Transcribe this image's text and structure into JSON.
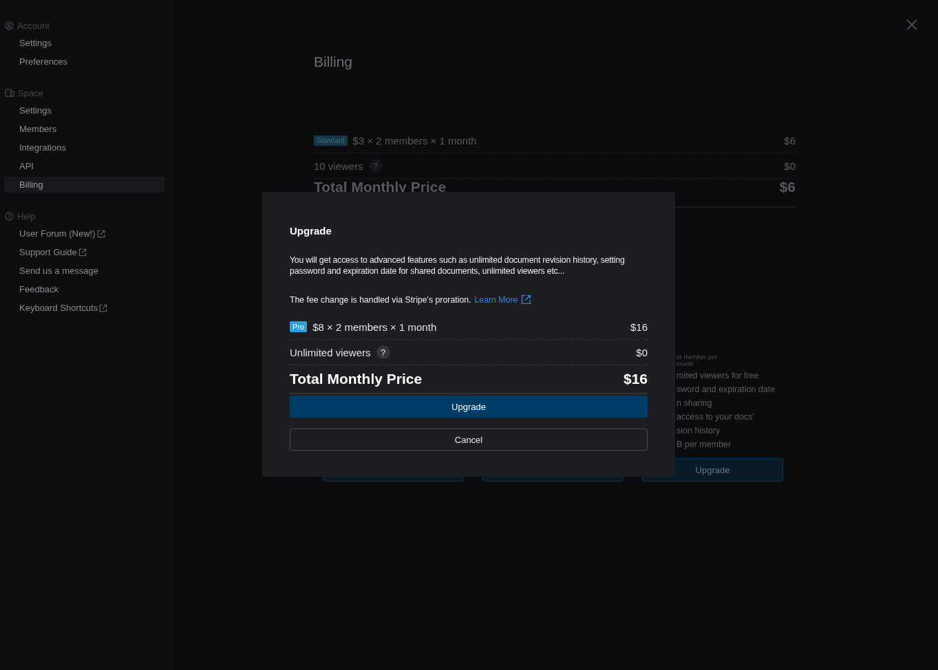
{
  "sidebar": {
    "sections": [
      {
        "kind": "account",
        "title": "Account",
        "items": [
          {
            "label": "Settings",
            "selected": false,
            "external": false
          },
          {
            "label": "Preferences",
            "selected": false,
            "external": false
          }
        ]
      },
      {
        "kind": "space",
        "title": "Space",
        "items": [
          {
            "label": "Settings",
            "selected": false,
            "external": false
          },
          {
            "label": "Members",
            "selected": false,
            "external": false
          },
          {
            "label": "Integrations",
            "selected": false,
            "external": false
          },
          {
            "label": "API",
            "selected": false,
            "external": false
          },
          {
            "label": "Billing",
            "selected": true,
            "external": false
          }
        ]
      },
      {
        "kind": "help",
        "title": "Help",
        "items": [
          {
            "label": "User Forum (New!)",
            "selected": false,
            "external": true
          },
          {
            "label": "Support Guide",
            "selected": false,
            "external": true
          },
          {
            "label": "Send us a message",
            "selected": false,
            "external": false
          },
          {
            "label": "Feedback",
            "selected": false,
            "external": false
          },
          {
            "label": "Keyboard Shortcuts",
            "selected": false,
            "external": true
          }
        ]
      }
    ]
  },
  "page": {
    "title": "Billing",
    "lines": [
      {
        "badge": "Standard",
        "label": "$3 × 2 members × 1 month",
        "amount": "$6"
      },
      {
        "label": "10 viewers",
        "help": "?",
        "amount": "$0"
      }
    ],
    "total": {
      "label": "Total Monthly Price",
      "amount": "$6"
    },
    "plans": [
      {
        "kind": "covered"
      },
      {
        "kind": "covered"
      },
      {
        "kind": "visible",
        "price_note": [
          "er member per",
          "month"
        ],
        "lines": [
          "mited viewers for free",
          "sword and expiration date",
          "n sharing",
          "access to your docs'",
          "sion history",
          "B per member"
        ],
        "button": "Upgrade"
      }
    ]
  },
  "dialog": {
    "title": "Upgrade",
    "description": "You will get access to advanced features such as unlimited document revision history, setting password and expiration date for shared documents, unlimited viewers etc...",
    "note": "The fee change is handled via Stripe's proration.",
    "link": "Learn More",
    "lines": [
      {
        "badge": "Pro",
        "label": "$8 × 2 members × 1 month",
        "amount": "$16"
      },
      {
        "label": "Unlimited viewers",
        "help": "?",
        "amount": "$0"
      }
    ],
    "total": {
      "label": "Total Monthly Price",
      "amount": "$16"
    },
    "buttons": [
      {
        "kind": "primary",
        "label": "Upgrade"
      },
      {
        "kind": "secondary",
        "label": "Cancel"
      }
    ]
  }
}
